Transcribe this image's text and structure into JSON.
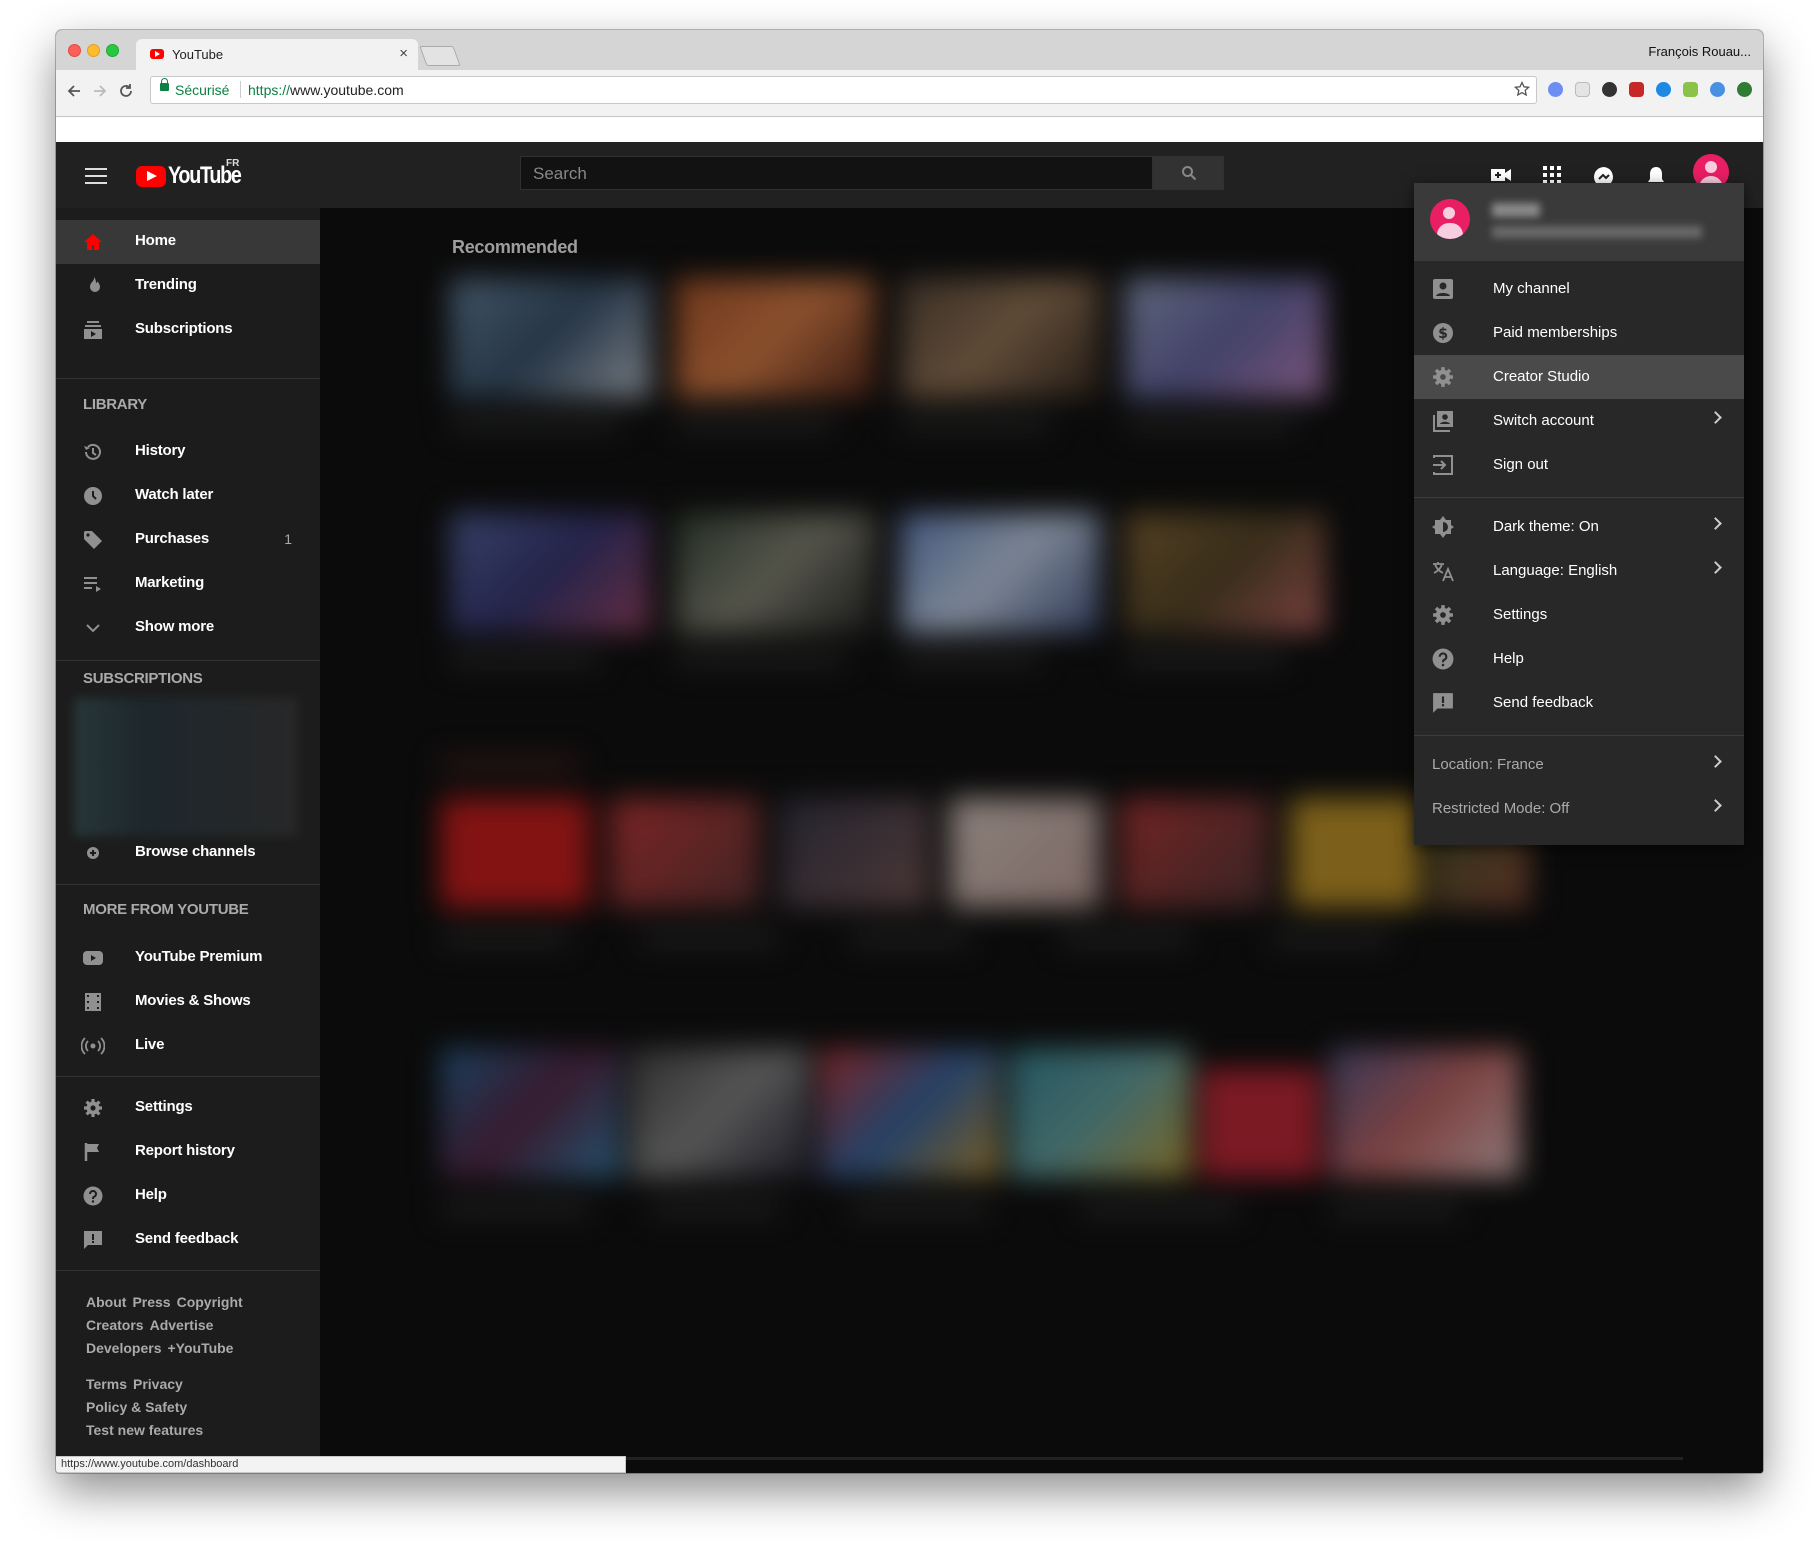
{
  "browser": {
    "tab_title": "YouTube",
    "tab_close": "×",
    "profile_name": "François Rouau...",
    "secure_label": "Sécurisé",
    "url_protocol": "https://",
    "url_rest": "www.youtube.com",
    "status_url": "https://www.youtube.com/dashboard"
  },
  "header": {
    "logo_text": "YouTube",
    "logo_country": "FR",
    "search_placeholder": "Search"
  },
  "sidebar": {
    "main_items": [
      {
        "label": "Home",
        "icon": "home-icon"
      },
      {
        "label": "Trending",
        "icon": "flame-icon"
      },
      {
        "label": "Subscriptions",
        "icon": "subscriptions-icon"
      }
    ],
    "library_heading": "LIBRARY",
    "library_items": [
      {
        "label": "History",
        "icon": "history-icon",
        "count": ""
      },
      {
        "label": "Watch later",
        "icon": "clock-icon",
        "count": ""
      },
      {
        "label": "Purchases",
        "icon": "tag-icon",
        "count": "1"
      },
      {
        "label": "Marketing",
        "icon": "playlist-icon",
        "count": ""
      },
      {
        "label": "Show more",
        "icon": "chevron-down-icon",
        "count": ""
      }
    ],
    "subscriptions_heading": "SUBSCRIPTIONS",
    "browse_channels": "Browse channels",
    "more_heading": "MORE FROM YOUTUBE",
    "more_items": [
      {
        "label": "YouTube Premium",
        "icon": "youtube-icon"
      },
      {
        "label": "Movies & Shows",
        "icon": "film-icon"
      },
      {
        "label": "Live",
        "icon": "live-icon"
      }
    ],
    "settings_items": [
      {
        "label": "Settings",
        "icon": "gear-icon"
      },
      {
        "label": "Report history",
        "icon": "flag-icon"
      },
      {
        "label": "Help",
        "icon": "help-icon"
      },
      {
        "label": "Send feedback",
        "icon": "feedback-icon"
      }
    ],
    "footer_line1": [
      "About",
      "Press",
      "Copyright"
    ],
    "footer_line2": [
      "Creators",
      "Advertise"
    ],
    "footer_line3": [
      "Developers",
      "+YouTube"
    ],
    "footer_line4": [
      "Terms",
      "Privacy"
    ],
    "footer_line5": [
      "Policy & Safety"
    ],
    "footer_line6": [
      "Test new features"
    ]
  },
  "main": {
    "section_title": "Recommended"
  },
  "account_menu": {
    "items": [
      {
        "label": "My channel",
        "icon": "account-box-icon",
        "chevron": false
      },
      {
        "label": "Paid memberships",
        "icon": "dollar-icon",
        "chevron": false
      },
      {
        "label": "Creator Studio",
        "icon": "gear-icon",
        "chevron": false
      },
      {
        "label": "Switch account",
        "icon": "switch-account-icon",
        "chevron": true
      },
      {
        "label": "Sign out",
        "icon": "sign-out-icon",
        "chevron": false
      }
    ],
    "items2": [
      {
        "label": "Dark theme: On",
        "icon": "brightness-icon",
        "chevron": true
      },
      {
        "label": "Language: English",
        "icon": "translate-icon",
        "chevron": true
      },
      {
        "label": "Settings",
        "icon": "gear-icon",
        "chevron": false
      },
      {
        "label": "Help",
        "icon": "help-icon",
        "chevron": false
      },
      {
        "label": "Send feedback",
        "icon": "feedback-icon",
        "chevron": false
      }
    ],
    "location": "Location: France",
    "restricted": "Restricted Mode: Off"
  },
  "colors": {
    "accent_red": "#ff0000",
    "avatar_pink": "#e91e63",
    "header_bg": "#212121",
    "page_bg": "#121212"
  }
}
